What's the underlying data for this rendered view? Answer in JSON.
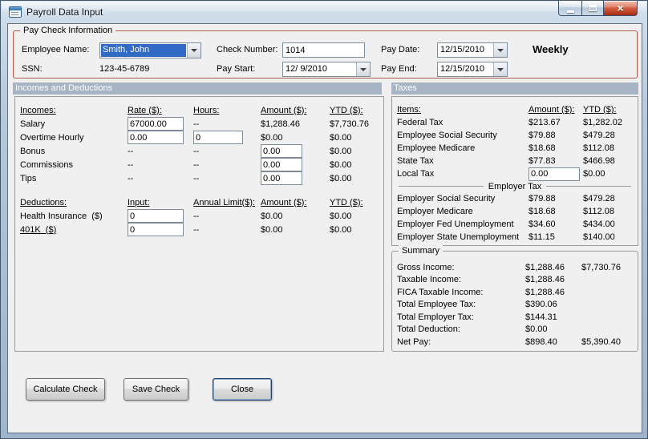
{
  "window": {
    "title": "Payroll Data Input"
  },
  "icons": {
    "close": "×"
  },
  "colors": {
    "section_header_bg": "#a6b4c4",
    "paycheck_border": "#b25b4b",
    "selection_bg": "#316ac5"
  },
  "paycheck": {
    "legend": "Pay Check Information",
    "fields": {
      "employee_name": {
        "label": "Employee Name:",
        "value": "Smith, John"
      },
      "ssn": {
        "label": "SSN:",
        "value": "123-45-6789"
      },
      "check_number": {
        "label": "Check Number:",
        "value": "1014"
      },
      "pay_start": {
        "label": "Pay Start:",
        "value": "12/ 9/2010"
      },
      "pay_date": {
        "label": "Pay Date:",
        "value": "12/15/2010"
      },
      "pay_end": {
        "label": "Pay End:",
        "value": "12/15/2010"
      }
    },
    "frequency": "Weekly"
  },
  "sections": {
    "incomes_deductions_header": "Incomes and Deductions",
    "taxes_header": "Taxes",
    "employer_tax_divider": "Employer Tax"
  },
  "incomes": {
    "headers": {
      "name": "Incomes:",
      "rate": "Rate ($):",
      "hours": "Hours:",
      "amount": "Amount ($):",
      "ytd": "YTD ($):"
    },
    "rows": [
      {
        "name": "Salary",
        "rate": "67000.00",
        "hours": "--",
        "amount": "$1,288.46",
        "ytd": "$7,730.76"
      },
      {
        "name": "Overtime Hourly",
        "rate": "0.00",
        "hours": "0",
        "amount": "$0.00",
        "ytd": "$0.00"
      },
      {
        "name": "Bonus",
        "rate": "--",
        "hours": "--",
        "amount": "0.00",
        "ytd": "$0.00"
      },
      {
        "name": "Commissions",
        "rate": "--",
        "hours": "--",
        "amount": "0.00",
        "ytd": "$0.00"
      },
      {
        "name": "Tips",
        "rate": "--",
        "hours": "--",
        "amount": "0.00",
        "ytd": "$0.00"
      }
    ]
  },
  "deductions": {
    "headers": {
      "name": "Deductions:",
      "input": "Input:",
      "limit": "Annual Limit($):",
      "amount": "Amount ($):",
      "ytd": "YTD ($):"
    },
    "rows": [
      {
        "name": "Health Insurance  ($)",
        "input": "0",
        "limit": "--",
        "amount": "$0.00",
        "ytd": "$0.00"
      },
      {
        "name": "401K  ($)",
        "input": "0",
        "limit": "--",
        "amount": "$0.00",
        "ytd": "$0.00"
      }
    ]
  },
  "taxes": {
    "headers": {
      "name": "Items:",
      "amount": "Amount ($):",
      "ytd": "YTD ($):"
    },
    "employee_rows": [
      {
        "name": "Federal Tax",
        "amount": "$213.67",
        "ytd": "$1,282.02"
      },
      {
        "name": "Employee Social Security",
        "amount": "$79.88",
        "ytd": "$479.28"
      },
      {
        "name": "Employee Medicare",
        "amount": "$18.68",
        "ytd": "$112.08"
      },
      {
        "name": "State Tax",
        "amount": "$77.83",
        "ytd": "$466.98"
      },
      {
        "name": "Local Tax",
        "amount": "0.00",
        "ytd": "$0.00"
      }
    ],
    "employer_rows": [
      {
        "name": "Employer Social Security",
        "amount": "$79.88",
        "ytd": "$479.28"
      },
      {
        "name": "Employer Medicare",
        "amount": "$18.68",
        "ytd": "$112.08"
      },
      {
        "name": "Employer Fed Unemployment",
        "amount": "$34.60",
        "ytd": "$434.00"
      },
      {
        "name": "Employer State Unemployment",
        "amount": "$11.15",
        "ytd": "$140.00"
      }
    ]
  },
  "summary": {
    "legend": "Summary",
    "rows": [
      {
        "name": "Gross Income:",
        "amount": "$1,288.46",
        "ytd": "$7,730.76"
      },
      {
        "name": "Taxable Income:",
        "amount": "$1,288.46",
        "ytd": ""
      },
      {
        "name": "FICA Taxable Income:",
        "amount": "$1,288.46",
        "ytd": ""
      },
      {
        "name": "Total Employee Tax:",
        "amount": "$390.06",
        "ytd": ""
      },
      {
        "name": "Total Employer Tax:",
        "amount": "$144.31",
        "ytd": ""
      },
      {
        "name": "Total Deduction:",
        "amount": "$0.00",
        "ytd": ""
      },
      {
        "name": "Net Pay:",
        "amount": "$898.40",
        "ytd": "$5,390.40"
      }
    ]
  },
  "buttons": {
    "calculate": "Calculate Check",
    "save": "Save Check",
    "close": "Close"
  }
}
